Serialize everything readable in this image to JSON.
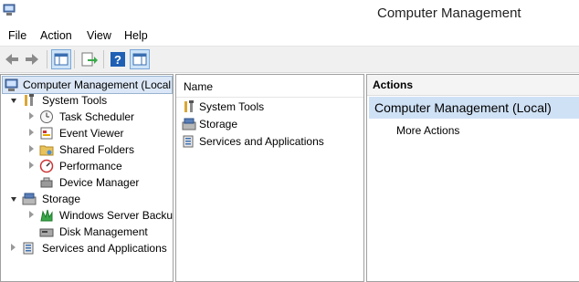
{
  "window": {
    "title": "Computer Management"
  },
  "menu": [
    "File",
    "Action",
    "View",
    "Help"
  ],
  "toolbar": {
    "icons": [
      "back-arrow-icon",
      "forward-arrow-icon",
      "show-hide-console-tree-icon",
      "export-list-icon",
      "help-icon",
      "show-hide-action-pane-icon"
    ]
  },
  "tree": {
    "root": "Computer Management (Local",
    "items": [
      {
        "label": "System Tools",
        "level": 1,
        "state": "expanded"
      },
      {
        "label": "Task Scheduler",
        "level": 2,
        "state": "collapsed"
      },
      {
        "label": "Event Viewer",
        "level": 2,
        "state": "collapsed"
      },
      {
        "label": "Shared Folders",
        "level": 2,
        "state": "collapsed"
      },
      {
        "label": "Performance",
        "level": 2,
        "state": "collapsed"
      },
      {
        "label": "Device Manager",
        "level": 2,
        "state": "none"
      },
      {
        "label": "Storage",
        "level": 1,
        "state": "expanded"
      },
      {
        "label": "Windows Server Backup",
        "level": 2,
        "state": "collapsed"
      },
      {
        "label": "Disk Management",
        "level": 2,
        "state": "none"
      },
      {
        "label": "Services and Applications",
        "level": 1,
        "state": "collapsed"
      }
    ]
  },
  "list": {
    "column_header": "Name",
    "items": [
      "System Tools",
      "Storage",
      "Services and Applications"
    ]
  },
  "actions": {
    "header": "Actions",
    "selected_item": "Computer Management (Local)",
    "more_actions": "More Actions"
  }
}
